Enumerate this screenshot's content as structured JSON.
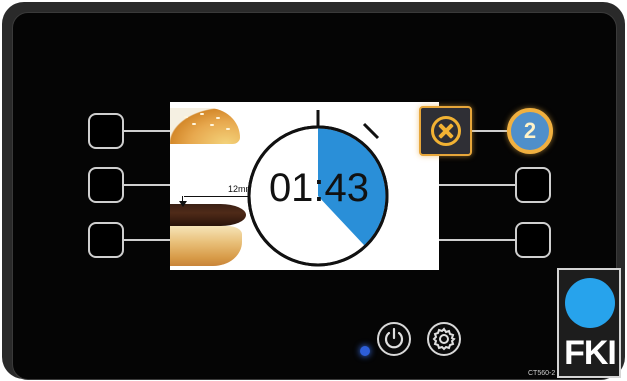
{
  "timer": {
    "display": "01:43",
    "remaining_fraction": 0.38,
    "fill_color": "#2a8fd8"
  },
  "image": {
    "thickness_label": "12mm"
  },
  "controls": {
    "cancel_icon": "cancel-circle-icon",
    "power_icon": "power-icon",
    "settings_icon": "gear-icon"
  },
  "step_badge": "2",
  "brand": {
    "logo_text": "FKI",
    "model": "CT560-2",
    "logo_color": "#27a3ec",
    "accent_color": "#f0b040"
  }
}
